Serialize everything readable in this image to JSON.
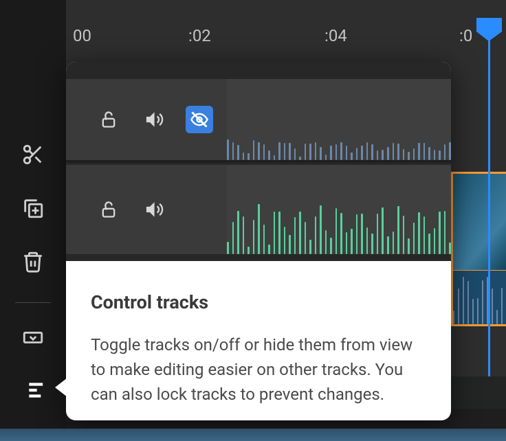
{
  "ruler": {
    "t0": "00",
    "t1": ":02",
    "t2": ":04",
    "t3": ":0"
  },
  "tooltip": {
    "title": "Control tracks",
    "body": "Toggle tracks on/off or hide them from view to make editing easier on other tracks. You can also lock tracks to prevent changes."
  },
  "tools": {
    "scissors": "scissors-icon",
    "duplicate": "duplicate-icon",
    "trash": "trash-icon",
    "crop": "crop-icon",
    "tracks": "tracks-panel-icon"
  },
  "track_controls": {
    "lock": "unlock-icon",
    "mute": "volume-icon",
    "hide": "eye-off-icon"
  },
  "colors": {
    "accent": "#2a8cff",
    "clip_border": "#ff9b2f",
    "wave_green": "#59cf9f",
    "wave_blue": "#6d88a8"
  }
}
